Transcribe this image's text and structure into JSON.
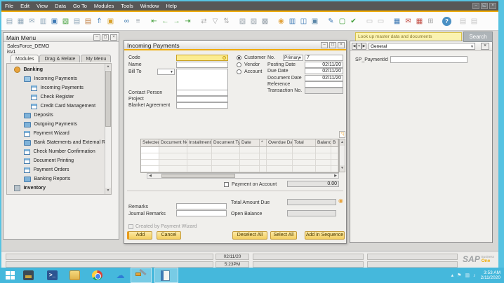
{
  "app": {
    "menu": [
      "File",
      "Edit",
      "View",
      "Data",
      "Go To",
      "Modules",
      "Tools",
      "Window",
      "Help"
    ],
    "window_controls": {
      "minimize": "–",
      "maximize": "◻",
      "restore": "◱",
      "close": "×"
    }
  },
  "toolbar": {
    "icons": [
      {
        "name": "preview-icon",
        "glyph": "▤",
        "color": "#8FA6B8"
      },
      {
        "name": "print-icon",
        "glyph": "▦",
        "color": "#8FA6B8"
      },
      {
        "name": "email-icon",
        "glyph": "✉",
        "color": "#8FA6B8"
      },
      {
        "name": "export-page-icon",
        "glyph": "▥",
        "color": "#8FA6B8"
      },
      {
        "name": "print-layout-icon",
        "glyph": "▣",
        "color": "#3E79B4"
      },
      {
        "name": "export-excel-icon",
        "glyph": "▧",
        "color": "#44A03C"
      },
      {
        "name": "export-word-icon",
        "glyph": "▤",
        "color": "#8FA6B8"
      },
      {
        "name": "export-pdf-icon",
        "glyph": "▤",
        "color": "#C17F42"
      },
      {
        "name": "launch-app-icon",
        "glyph": "⇑",
        "color": "#3E79B4"
      },
      {
        "name": "lock-icon",
        "glyph": "▣",
        "color": "#D8A12C"
      },
      {
        "name": "find-icon",
        "glyph": "∞",
        "color": "#2D6EA8"
      },
      {
        "name": "list-icon",
        "glyph": "≡",
        "color": "#9AA4AC"
      },
      {
        "name": "first-record-icon",
        "glyph": "⇤",
        "color": "#44A03C"
      },
      {
        "name": "previous-record-icon",
        "glyph": "←",
        "color": "#44A03C"
      },
      {
        "name": "next-record-icon",
        "glyph": "→",
        "color": "#44A03C"
      },
      {
        "name": "last-record-icon",
        "glyph": "⇥",
        "color": "#44A03C"
      },
      {
        "name": "refresh-icon",
        "glyph": "⇄",
        "color": "#ABABAB"
      },
      {
        "name": "filter-icon",
        "glyph": "▽",
        "color": "#ABABAB"
      },
      {
        "name": "sort-icon",
        "glyph": "⇅",
        "color": "#ABABAB"
      },
      {
        "name": "copy-icon",
        "glyph": "▧",
        "color": "#9AA4AC"
      },
      {
        "name": "paste-icon",
        "glyph": "▨",
        "color": "#9AA4AC"
      },
      {
        "name": "duplicate-icon",
        "glyph": "▩",
        "color": "#9AA4AC"
      },
      {
        "name": "payment-means-icon",
        "glyph": "◉",
        "color": "#E2A33C"
      },
      {
        "name": "price-report-icon",
        "glyph": "▥",
        "color": "#3E79B4"
      },
      {
        "name": "split-window-icon",
        "glyph": "◫",
        "color": "#3E79B4"
      },
      {
        "name": "magnify-window-icon",
        "glyph": "▣",
        "color": "#5B87A8"
      },
      {
        "name": "edit-icon",
        "glyph": "✎",
        "color": "#3E79B4"
      },
      {
        "name": "new-document-icon",
        "glyph": "▢",
        "color": "#44A03C"
      },
      {
        "name": "document-confirm-icon",
        "glyph": "✔",
        "color": "#44A03C"
      },
      {
        "name": "comment-icon",
        "glyph": "▭",
        "color": "#B8B8B8"
      },
      {
        "name": "comment2-icon",
        "glyph": "▭",
        "color": "#B8B8B8"
      },
      {
        "name": "calendar-icon",
        "glyph": "▦",
        "color": "#3E79B4"
      },
      {
        "name": "message-alert-icon",
        "glyph": "✉",
        "color": "#C14B42"
      },
      {
        "name": "report-alert-icon",
        "glyph": "▦",
        "color": "#C14B42"
      },
      {
        "name": "org-chart-icon",
        "glyph": "⊞",
        "color": "#ABABAB"
      },
      {
        "name": "help-icon",
        "glyph": "?",
        "color": "#FFFFFF"
      },
      {
        "name": "form-settings-icon",
        "glyph": "▤",
        "color": "#C6C6C6"
      },
      {
        "name": "form-settings2-icon",
        "glyph": "▤",
        "color": "#C6C6C6"
      }
    ]
  },
  "sidebar": {
    "title": "Main Menu",
    "company": "SalesForce_DEMO",
    "user": "isv1",
    "tabs": [
      {
        "label": "Modules"
      },
      {
        "label": "Drag & Relate"
      },
      {
        "label": "My Menu"
      }
    ],
    "items": [
      {
        "label": "Banking",
        "icon": "moneybag-icon"
      },
      {
        "label": "Incoming Payments",
        "icon": "folder-open-icon"
      },
      {
        "label": "Incoming Payments",
        "icon": "document-icon"
      },
      {
        "label": "Check Register",
        "icon": "document-icon"
      },
      {
        "label": "Credit Card Management",
        "icon": "document-icon"
      },
      {
        "label": "Deposits",
        "icon": "folder-icon"
      },
      {
        "label": "Outgoing Payments",
        "icon": "folder-icon"
      },
      {
        "label": "Payment Wizard",
        "icon": "document-icon"
      },
      {
        "label": "Bank Statements and External Reconcil",
        "icon": "folder-icon"
      },
      {
        "label": "Check Number Confirmation",
        "icon": "document-icon"
      },
      {
        "label": "Document Printing",
        "icon": "document-icon"
      },
      {
        "label": "Payment Orders",
        "icon": "document-icon"
      },
      {
        "label": "Banking Reports",
        "icon": "folder-icon"
      },
      {
        "label": "Inventory",
        "icon": "box-icon"
      }
    ]
  },
  "search": {
    "hint": "Look up master data and documents",
    "button_label": "Search"
  },
  "pw": {
    "title": "Incoming Payments",
    "code_label": "Code",
    "name_label": "Name",
    "bill_to_label": "Bill To",
    "contact_person_label": "Contact Person",
    "project_label": "Project",
    "blanket_label": "Blanket Agreement",
    "radios": [
      {
        "label": "Customer",
        "selected": true
      },
      {
        "label": "Vendor",
        "selected": false
      },
      {
        "label": "Account",
        "selected": false
      }
    ],
    "no_label": "No.",
    "series": "Primary",
    "number": "7",
    "posting_date_label": "Posting Date",
    "posting_date": "02/11/20",
    "due_date_label": "Due Date",
    "due_date": "02/11/20",
    "document_date_label": "Document Date",
    "document_date": "02/11/20",
    "reference_label": "Reference",
    "transaction_no_label": "Transaction No.",
    "table": {
      "headers": [
        "Selected",
        "Document No.",
        "Installment",
        "Document Type",
        "Date",
        "*",
        "Overdue Days",
        "Total",
        "Balance Due",
        "B"
      ]
    },
    "payment_on_account_label": "Payment on Account",
    "payment_on_account_value": "0.00",
    "total_amount_due_label": "Total Amount Due",
    "open_balance_label": "Open Balance",
    "remarks_label": "Remarks",
    "journal_remarks_label": "Journal Remarks",
    "created_by_wizard_label": "Created by Payment Wizard",
    "buttons": {
      "add": "Add",
      "cancel": "Cancel",
      "deselect_all": "Deselect All",
      "select_all": "Select All",
      "add_in_sequence": "Add in Sequence"
    }
  },
  "udf": {
    "nav_prev": "◀",
    "nav_drop": "▾",
    "nav_next": "▶",
    "view": "General",
    "close": "×",
    "field_label": "SP_PaymentId"
  },
  "statusbar": {
    "date": "02/11/20",
    "time": "5:23PM",
    "logo": {
      "sap": "SAP",
      "business": "Business",
      "one": "One"
    }
  },
  "taskbar": {
    "clock_time": "3:53 AM",
    "clock_date": "2/11/2020"
  }
}
